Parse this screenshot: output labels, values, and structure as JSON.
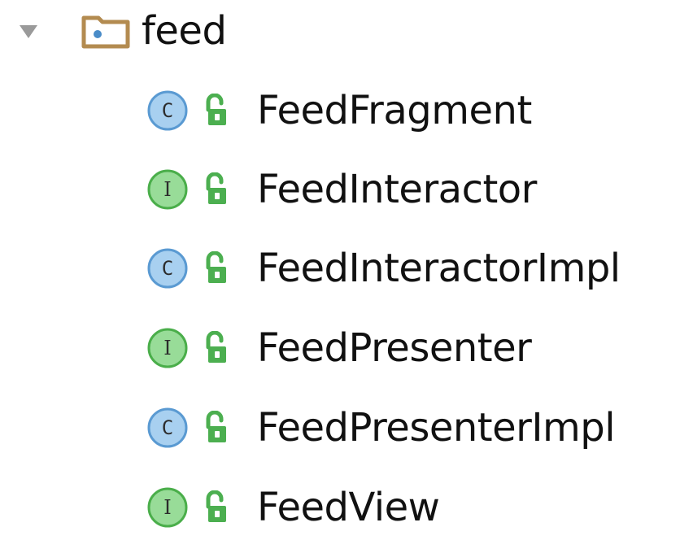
{
  "tree": {
    "package": {
      "name": "feed",
      "expanded_icon": "chevron-down-icon",
      "icon": "package-folder-icon"
    },
    "items": [
      {
        "name": "FeedFragment",
        "kind": "class",
        "icon": "class-icon",
        "visibility": "public",
        "visibility_icon": "unlock-icon"
      },
      {
        "name": "FeedInteractor",
        "kind": "interface",
        "icon": "interface-icon",
        "visibility": "public",
        "visibility_icon": "unlock-icon"
      },
      {
        "name": "FeedInteractorImpl",
        "kind": "class",
        "icon": "class-icon",
        "visibility": "public",
        "visibility_icon": "unlock-icon"
      },
      {
        "name": "FeedPresenter",
        "kind": "interface",
        "icon": "interface-icon",
        "visibility": "public",
        "visibility_icon": "unlock-icon"
      },
      {
        "name": "FeedPresenterImpl",
        "kind": "class",
        "icon": "class-icon",
        "visibility": "public",
        "visibility_icon": "unlock-icon"
      },
      {
        "name": "FeedView",
        "kind": "interface",
        "icon": "interface-icon",
        "visibility": "public",
        "visibility_icon": "unlock-icon"
      }
    ],
    "icon_letters": {
      "class": "C",
      "interface": "I"
    },
    "colors": {
      "class_fill": "#a8d0f0",
      "class_stroke": "#4a8cc8",
      "interface_fill": "#98dc98",
      "interface_stroke": "#3aa03a",
      "lock": "#4caf50",
      "folder_border": "#b38b50",
      "folder_dot": "#4a8cc8",
      "chevron": "#999999"
    }
  }
}
